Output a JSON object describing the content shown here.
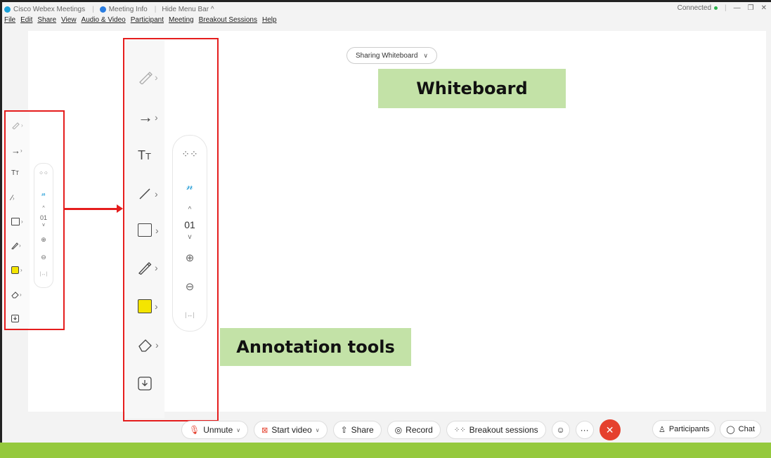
{
  "titlebar": {
    "app_name": "Cisco Webex Meetings",
    "meeting_info": "Meeting Info",
    "hide_menu": "Hide Menu Bar ^",
    "status": "Connected"
  },
  "menu": [
    "File",
    "Edit",
    "Share",
    "View",
    "Audio & Video",
    "Participant",
    "Meeting",
    "Breakout Sessions",
    "Help"
  ],
  "sharing": {
    "label": "Sharing Whiteboard"
  },
  "labels": {
    "whiteboard": "Whiteboard",
    "annotation": "Annotation tools"
  },
  "tools": [
    "pen-icon",
    "arrow-icon",
    "text-icon",
    "line-icon",
    "rectangle-icon",
    "pencil-icon",
    "color-icon",
    "eraser-icon",
    "save-icon"
  ],
  "subpanel": {
    "page": "01"
  },
  "controls": {
    "unmute": "Unmute",
    "start_video": "Start video",
    "share": "Share",
    "record": "Record",
    "breakout": "Breakout sessions",
    "more": "···",
    "participants": "Participants",
    "chat": "Chat"
  },
  "colors": {
    "accent_red": "#e51d1d",
    "label_green": "#c3e2a7",
    "bottom_green": "#95c93d",
    "annotation_yellow": "#f4e500",
    "end_red": "#e5412e"
  }
}
